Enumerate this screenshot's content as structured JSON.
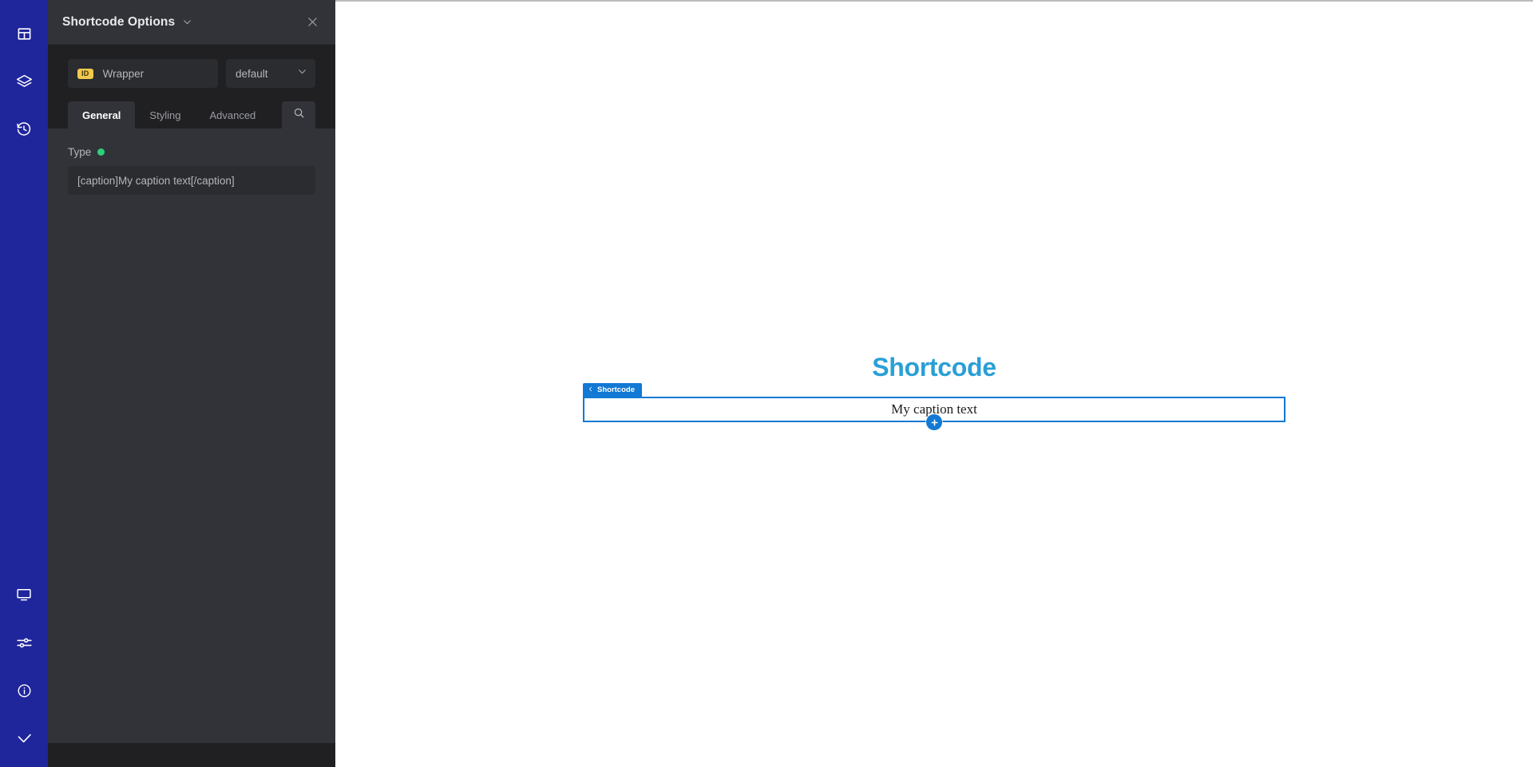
{
  "rail": {
    "top_items": [
      {
        "name": "layout-icon",
        "label": "Layout"
      },
      {
        "name": "layers-icon",
        "label": "Layers"
      },
      {
        "name": "history-icon",
        "label": "History"
      }
    ],
    "bottom_items": [
      {
        "name": "responsive-icon",
        "label": "Responsive"
      },
      {
        "name": "settings-sliders-icon",
        "label": "Settings"
      },
      {
        "name": "info-icon",
        "label": "Info"
      },
      {
        "name": "check-icon",
        "label": "Save"
      }
    ],
    "accent_color": "#1f259b"
  },
  "panel": {
    "title": "Shortcode Options",
    "caret_icon": "chevron-down-icon",
    "close_icon": "close-icon",
    "id_badge": "ID",
    "id_value": "Wrapper",
    "id_placeholder": "Wrapper",
    "select_value": "default",
    "select_options": [
      "default"
    ],
    "tabs": [
      {
        "label": "General",
        "active": true
      },
      {
        "label": "Styling",
        "active": false
      },
      {
        "label": "Advanced",
        "active": false
      }
    ],
    "search_icon": "search-icon",
    "fields": [
      {
        "label": "Type",
        "status_dot_color": "#2bd17e",
        "value": "[caption]My caption text[/caption]",
        "placeholder": "[caption]My caption text[/caption]"
      }
    ]
  },
  "canvas": {
    "page_title": "Shortcode",
    "page_title_color": "#2a9fd6",
    "element": {
      "badge_label": "Shortcode",
      "badge_icon": "chevron-left-icon",
      "badge_color": "#1279d4",
      "caption_text": "My caption text",
      "add_button_icon": "plus-icon"
    }
  }
}
